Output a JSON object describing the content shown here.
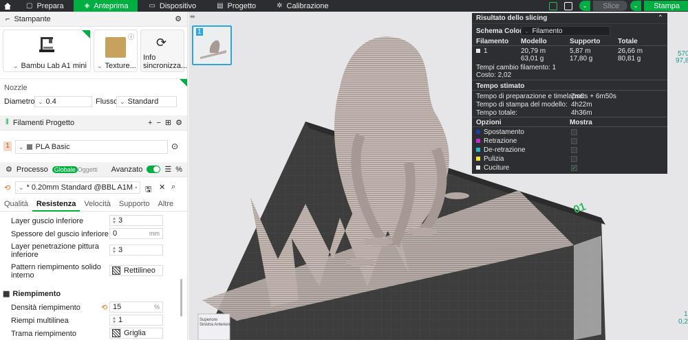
{
  "topbar": {
    "tabs": [
      {
        "label": "Prepara"
      },
      {
        "label": "Anteprima"
      },
      {
        "label": "Dispositivo"
      },
      {
        "label": "Progetto"
      },
      {
        "label": "Calibrazione"
      }
    ],
    "slice": "Slice",
    "print": "Stampa"
  },
  "printer": {
    "section": "Stampante",
    "model": "Bambu Lab A1 mini",
    "plate": "Texture...",
    "sync": "Info sincronizza..."
  },
  "nozzle": {
    "label": "Nozzle",
    "diameter_label": "Diametro",
    "diameter": "0.4",
    "flow_label": "Flusso",
    "flow": "Standard"
  },
  "filaments": {
    "section": "Filamenti Progetto",
    "items": [
      {
        "index": "1",
        "name": "PLA Basic"
      }
    ]
  },
  "process": {
    "section": "Processo",
    "global": "Globale",
    "objects": "Oggetti",
    "advanced": "Avanzato",
    "preset": "* 0.20mm Standard @BBL A1M - ...",
    "tabs": [
      "Qualità",
      "Resistenza",
      "Velocità",
      "Supporto",
      "Altre"
    ],
    "params": [
      {
        "label": "Layer guscio inferiore",
        "value": "3"
      },
      {
        "label": "Spessore del guscio inferiore",
        "value": "0",
        "unit": "mm"
      },
      {
        "label": "Layer penetrazione pittura inferiore",
        "value": "3"
      },
      {
        "label": "Pattern riempimento solido interno",
        "value": "Rettilineo"
      }
    ],
    "infill_section": "Riempimento",
    "infill": [
      {
        "label": "Densità riempimento",
        "value": "15",
        "unit": "%"
      },
      {
        "label": "Riempi multilinea",
        "value": "1"
      },
      {
        "label": "Trama riempimento",
        "value": "Griglia"
      }
    ]
  },
  "plate": {
    "number": "1",
    "label": "01"
  },
  "results": {
    "title": "Risultato dello slicing",
    "color_scheme_label": "Schema Colore",
    "color_scheme": "Filamento",
    "headers": [
      "Filamento",
      "Modello",
      "Supporto",
      "Totale"
    ],
    "row": {
      "id": "1",
      "model_len": "20,79 m",
      "model_w": "63,01 g",
      "supp_len": "5,87 m",
      "supp_w": "17,80 g",
      "tot_len": "26,66 m",
      "tot_w": "80,81 g"
    },
    "changes": "Tempi cambio filamento:  1",
    "cost": "Costo:  2,02",
    "time_title": "Tempo stimato",
    "prep_label": "Tempo di preparazione e timelapse:",
    "prep_val": "7m0s + 6m50s",
    "model_time_label": "Tempo di stampa del modello:",
    "model_time": "4h22m",
    "total_label": "Tempo totale:",
    "total": "4h36m",
    "opt_header": "Opzioni",
    "show_header": "Mostra",
    "options": [
      {
        "name": "Spostamento",
        "color": "#1e3ea8"
      },
      {
        "name": "Retrazione",
        "color": "#c42bc8"
      },
      {
        "name": "De-retrazione",
        "color": "#2ab7c8"
      },
      {
        "name": "Pulizia",
        "color": "#f2e23a"
      },
      {
        "name": "Cuciture",
        "color": "#e8e8e8"
      }
    ]
  },
  "layer_top": "570",
  "layer_top2": "97,8",
  "layer_bot": "1",
  "layer_bot2": "0,20",
  "cube": {
    "front": "Sinistra",
    "top": "Superiore",
    "right": "Anteriore"
  }
}
